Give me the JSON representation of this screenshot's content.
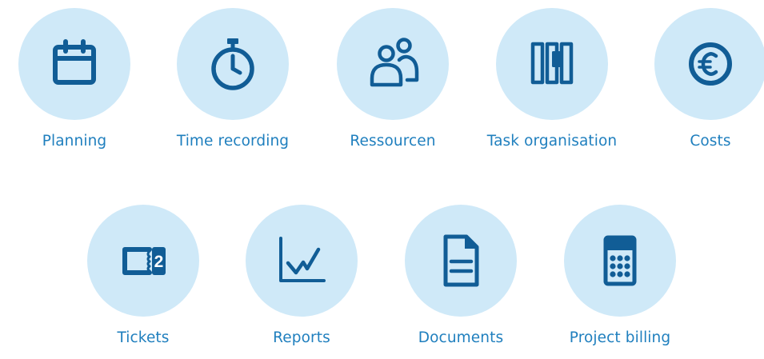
{
  "accent_color": "#1f7fbe",
  "icon_color": "#115d96",
  "circle_color": "#cfe9f8",
  "features": [
    {
      "label": "Planning",
      "icon": "calendar-icon"
    },
    {
      "label": "Time recording",
      "icon": "stopwatch-icon"
    },
    {
      "label": "Ressourcen",
      "icon": "people-icon"
    },
    {
      "label": "Task organisation",
      "icon": "kanban-icon"
    },
    {
      "label": "Costs",
      "icon": "euro-icon"
    },
    {
      "label": "Tickets",
      "icon": "ticket-icon"
    },
    {
      "label": "Reports",
      "icon": "line-chart-icon"
    },
    {
      "label": "Documents",
      "icon": "document-icon"
    },
    {
      "label": "Project billing",
      "icon": "calculator-icon"
    }
  ]
}
